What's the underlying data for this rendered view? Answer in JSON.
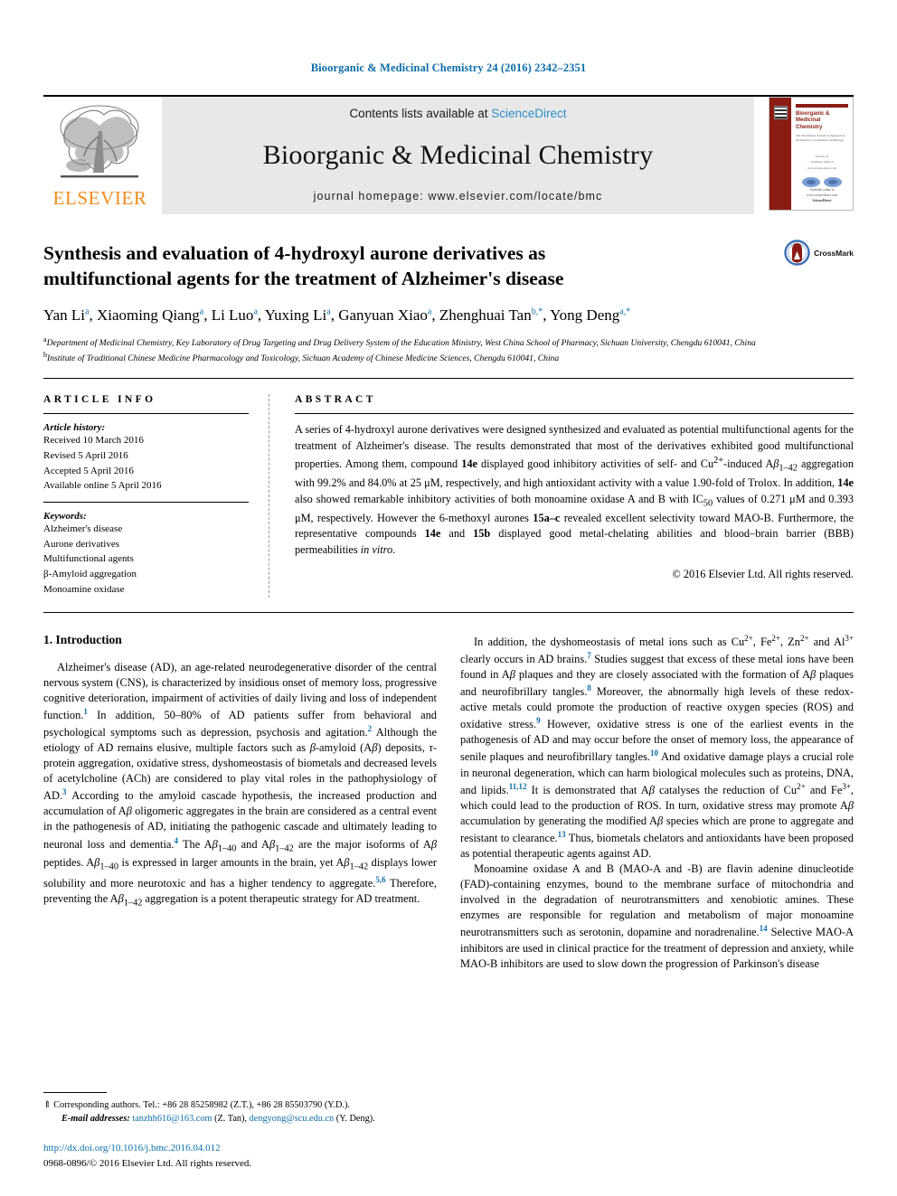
{
  "running_head": "Bioorganic & Medicinal Chemistry 24 (2016) 2342–2351",
  "masthead": {
    "publisher_name": "ELSEVIER",
    "contents_prefix": "Contents lists available at ",
    "contents_link": "ScienceDirect",
    "journal_name": "Bioorganic & Medicinal Chemistry",
    "homepage": "journal homepage: www.elsevier.com/locate/bmc",
    "cover": {
      "title": "Bioorganic & Medicinal Chemistry",
      "subtitle": "The Tetrahedron Journal for Research at the Interface of Chemistry and Biology",
      "mid_line_1": "Volume 24",
      "mid_line_2": "Available online at www.sciencedirect.com",
      "bottom_line_1": "Available online at www.sciencedirect.com",
      "bottom_line_2": "ScienceDirect"
    }
  },
  "crossmark": {
    "label": "CrossMark",
    "ring_color": "#3b6fb5",
    "bar_color": "#8b1c13"
  },
  "article": {
    "title_line_1": "Synthesis and evaluation of 4-hydroxyl aurone derivatives as",
    "title_line_2": "multifunctional agents for the treatment of Alzheimer's disease",
    "authors": [
      {
        "name": "Yan Li",
        "sup": "a"
      },
      {
        "name": "Xiaoming Qiang",
        "sup": "a"
      },
      {
        "name": "Li Luo",
        "sup": "a"
      },
      {
        "name": "Yuxing Li",
        "sup": "a"
      },
      {
        "name": "Ganyuan Xiao",
        "sup": "a"
      },
      {
        "name": "Zhenghuai Tan",
        "sup": "b,*"
      },
      {
        "name": "Yong Deng",
        "sup": "a,*"
      }
    ],
    "affiliations": [
      {
        "mark": "a",
        "text": "Department of Medicinal Chemistry, Key Laboratory of Drug Targeting and Drug Delivery System of the Education Ministry, West China School of Pharmacy, Sichuan University, Chengdu 610041, China"
      },
      {
        "mark": "b",
        "text": "Institute of Traditional Chinese Medicine Pharmacology and Toxicology, Sichuan Academy of Chinese Medicine Sciences, Chengdu 610041, China"
      }
    ]
  },
  "article_info": {
    "heading": "ARTICLE INFO",
    "history_label": "Article history:",
    "history": [
      "Received 10 March 2016",
      "Revised 5 April 2016",
      "Accepted 5 April 2016",
      "Available online 5 April 2016"
    ],
    "keywords_label": "Keywords:",
    "keywords": [
      "Alzheimer's disease",
      "Aurone derivatives",
      "Multifunctional agents",
      "β-Amyloid aggregation",
      "Monoamine oxidase"
    ]
  },
  "abstract": {
    "heading": "ABSTRACT",
    "text": "A series of 4-hydroxyl aurone derivatives were designed synthesized and evaluated as potential multifunctional agents for the treatment of Alzheimer's disease. The results demonstrated that most of the derivatives exhibited good multifunctional properties. Among them, compound 14e displayed good inhibitory activities of self- and Cu2+-induced Aβ1–42 aggregation with 99.2% and 84.0% at 25 μM, respectively, and high antioxidant activity with a value 1.90-fold of Trolox. In addition, 14e also showed remarkable inhibitory activities of both monoamine oxidase A and B with IC50 values of 0.271 μM and 0.393 μM, respectively. However the 6-methoxyl aurones 15a–c revealed excellent selectivity toward MAO-B. Furthermore, the representative compounds 14e and 15b displayed good metal-chelating abilities and blood–brain barrier (BBB) permeabilities in vitro.",
    "copyright": "© 2016 Elsevier Ltd. All rights reserved."
  },
  "body": {
    "section_heading": "1. Introduction",
    "left_paragraphs": [
      "Alzheimer's disease (AD), an age-related neurodegenerative disorder of the central nervous system (CNS), is characterized by insidious onset of memory loss, progressive cognitive deterioration, impairment of activities of daily living and loss of independent function.1 In addition, 50–80% of AD patients suffer from behavioral and psychological symptoms such as depression, psychosis and agitation.2 Although the etiology of AD remains elusive, multiple factors such as β-amyloid (Aβ) deposits, τ-protein aggregation, oxidative stress, dyshomeostasis of biometals and decreased levels of acetylcholine (ACh) are considered to play vital roles in the pathophysiology of AD.3 According to the amyloid cascade hypothesis, the increased production and accumulation of Aβ oligomeric aggregates in the brain are considered as a central event in the pathogenesis of AD, initiating the pathogenic cascade and ultimately leading to neuronal loss and dementia.4 The Aβ1–40 and Aβ1–42 are the major isoforms of Aβ peptides. Aβ1–40 is expressed in larger amounts in the brain, yet Aβ1–42 displays lower solubility and more neurotoxic and has a higher tendency to aggregate.5,6 Therefore, preventing the Aβ1–42 aggregation is a potent therapeutic strategy for AD treatment."
    ],
    "right_paragraphs": [
      "In addition, the dyshomeostasis of metal ions such as Cu2+, Fe2+, Zn2+ and Al3+ clearly occurs in AD brains.7 Studies suggest that excess of these metal ions have been found in Aβ plaques and they are closely associated with the formation of Aβ plaques and neurofibrillary tangles.8 Moreover, the abnormally high levels of these redox-active metals could promote the production of reactive oxygen species (ROS) and oxidative stress.9 However, oxidative stress is one of the earliest events in the pathogenesis of AD and may occur before the onset of memory loss, the appearance of senile plaques and neurofibrillary tangles.10 And oxidative damage plays a crucial role in neuronal degeneration, which can harm biological molecules such as proteins, DNA, and lipids.11,12 It is demonstrated that Aβ catalyses the reduction of Cu2+ and Fe3+, which could lead to the production of ROS. In turn, oxidative stress may promote Aβ accumulation by generating the modified Aβ species which are prone to aggregate and resistant to clearance.13 Thus, biometals chelators and antioxidants have been proposed as potential therapeutic agents against AD.",
      "Monoamine oxidase A and B (MAO-A and -B) are flavin adenine dinucleotide (FAD)-containing enzymes, bound to the membrane surface of mitochondria and involved in the degradation of neurotransmitters and xenobiotic amines. These enzymes are responsible for regulation and metabolism of major monoamine neurotransmitters such as serotonin, dopamine and noradrenaline.14 Selective MAO-A inhibitors are used in clinical practice for the treatment of depression and anxiety, while MAO-B inhibitors are used to slow down the progression of Parkinson's disease"
    ]
  },
  "footnotes": {
    "corresponding_marker": "⇑",
    "corresponding": "Corresponding authors. Tel.: +86 28 85258982 (Z.T.), +86 28 85503790 (Y.D.).",
    "email_label": "E-mail addresses:",
    "email_1": "tanzhh616@163.com",
    "email_1_who": "(Z. Tan),",
    "email_2": "dengyong@scu.edu.cn",
    "email_2_who": "(Y. Deng).",
    "doi": "http://dx.doi.org/10.1016/j.bmc.2016.04.012",
    "issn_line": "0968-0896/© 2016 Elsevier Ltd. All rights reserved."
  }
}
